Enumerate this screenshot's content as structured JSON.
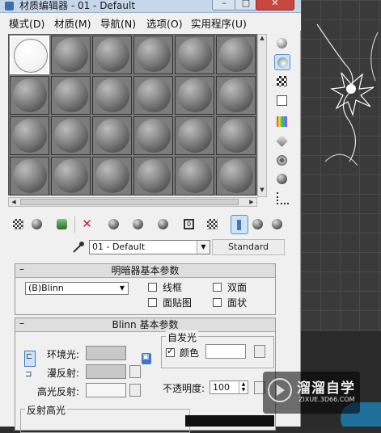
{
  "window": {
    "title": "材质编辑器 - 01 - Default"
  },
  "menubar": {
    "items": [
      "模式(D)",
      "材质(M)",
      "导航(N)",
      "选项(O)",
      "实用程序(U)"
    ]
  },
  "slots": {
    "rows": 4,
    "cols": 6,
    "selected_index": 0
  },
  "right_tools": [
    "sphere-sample-icon",
    "backlight-icon",
    "checker-background-icon",
    "tiling-icon",
    "video-color-check-icon",
    "make-preview-icon",
    "options-icon",
    "select-by-material-icon",
    "material-map-navigator-icon"
  ],
  "toolbar": [
    "get-material-icon",
    "put-to-scene-icon",
    "assign-to-selection-icon",
    "delete-icon",
    "make-unique-icon",
    "copy-material-icon",
    "put-to-library-icon",
    "material-id-icon",
    "show-map-icon",
    "show-end-result-icon",
    "go-to-parent-icon",
    "go-forward-icon"
  ],
  "material": {
    "name": "01 - Default",
    "type": "Standard"
  },
  "shader_rollout": {
    "title": "明暗器基本参数",
    "shader": "(B)Blinn",
    "checkboxes": [
      {
        "label": "线框",
        "checked": false
      },
      {
        "label": "双面",
        "checked": false
      },
      {
        "label": "面贴图",
        "checked": false
      },
      {
        "label": "面状",
        "checked": false
      }
    ]
  },
  "blinn_rollout": {
    "title": "Blinn 基本参数",
    "ambient_label": "环境光:",
    "diffuse_label": "漫反射:",
    "specular_label": "高光反射:",
    "self_illum": {
      "group_label": "自发光",
      "color_label": "颜色",
      "color_checked": true
    },
    "opacity_label": "不透明度:",
    "opacity_value": "100",
    "specular_highlights_label": "反射高光"
  },
  "watermark": {
    "line1": "溜溜自学",
    "line2": "ZIXUE.3D66.COM"
  },
  "colors": {
    "swatch_gray": "#c8c8c8",
    "swatch_white": "#ffffff",
    "accent": "#5b8fc7"
  }
}
